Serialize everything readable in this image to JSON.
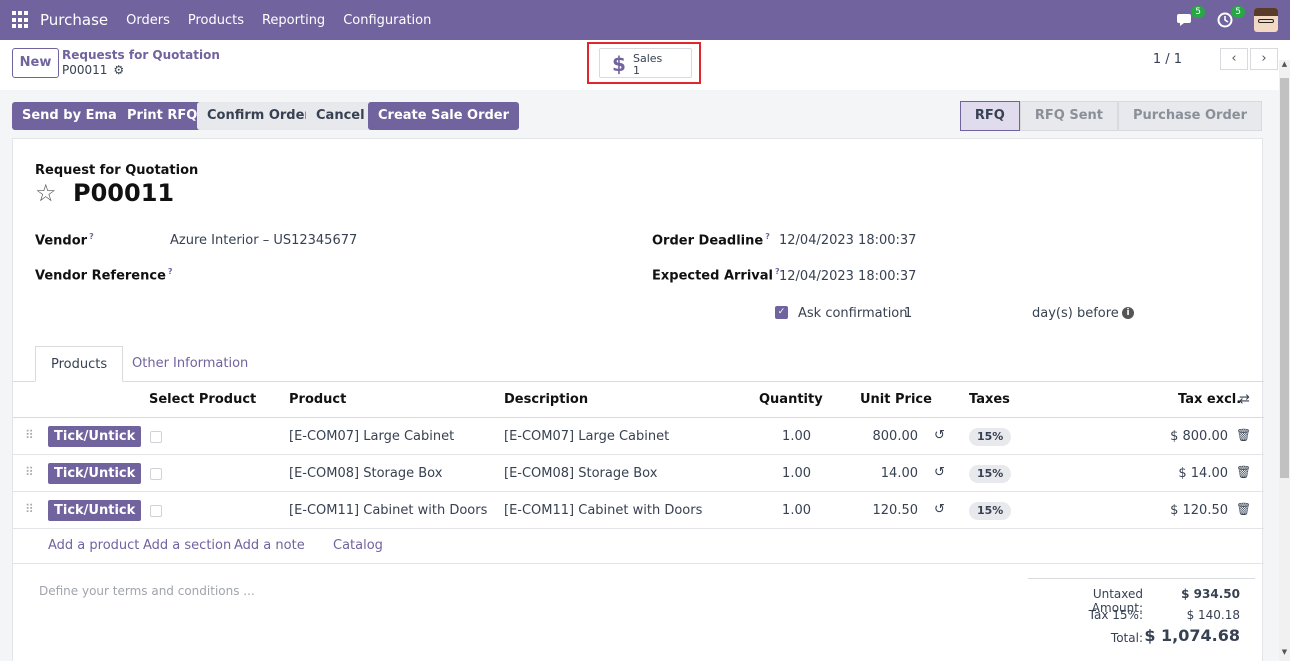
{
  "navbar": {
    "app_title": "Purchase",
    "menu": [
      "Orders",
      "Products",
      "Reporting",
      "Configuration"
    ],
    "messages_count": "5",
    "activities_count": "5"
  },
  "control": {
    "new_label": "New",
    "breadcrumb_parent": "Requests for Quotation",
    "breadcrumb_current": "P00011",
    "smart_button": {
      "label": "Sales",
      "value": "1",
      "icon": "dollar-icon"
    },
    "pager": "1 / 1"
  },
  "actions": {
    "send_email": "Send by Email",
    "print_rfq": "Print RFQ",
    "confirm_order": "Confirm Order",
    "cancel": "Cancel",
    "create_sale_order": "Create Sale Order"
  },
  "status": {
    "steps": [
      "RFQ",
      "RFQ Sent",
      "Purchase Order"
    ],
    "active": "RFQ"
  },
  "form": {
    "doc_type": "Request for Quotation",
    "name": "P00011",
    "vendor_label": "Vendor",
    "vendor_value": "Azure Interior – US12345677",
    "vendor_ref_label": "Vendor Reference",
    "deadline_label": "Order Deadline",
    "deadline_value": "12/04/2023 18:00:37",
    "arrival_label": "Expected Arrival",
    "arrival_value": "12/04/2023 18:00:37",
    "ask_confirmation_label": "Ask confirmation",
    "ask_confirmation_days": "1",
    "days_before": "day(s) before",
    "help_mark": "?"
  },
  "tabs": [
    "Products",
    "Other Information"
  ],
  "table": {
    "headers": {
      "select_product": "Select Product",
      "product": "Product",
      "description": "Description",
      "quantity": "Quantity",
      "unit_price": "Unit Price",
      "taxes": "Taxes",
      "tax_excl": "Tax excl."
    },
    "rows": [
      {
        "button": "Tick/Untick",
        "product": "[E-COM07] Large Cabinet",
        "description": "[E-COM07] Large Cabinet",
        "quantity": "1.00",
        "unit_price": "800.00",
        "tax": "15%",
        "subtotal": "$ 800.00"
      },
      {
        "button": "Tick/Untick",
        "product": "[E-COM08] Storage Box",
        "description": "[E-COM08] Storage Box",
        "quantity": "1.00",
        "unit_price": "14.00",
        "tax": "15%",
        "subtotal": "$ 14.00"
      },
      {
        "button": "Tick/Untick",
        "product": "[E-COM11] Cabinet with Doors",
        "description": "[E-COM11] Cabinet with Doors",
        "quantity": "1.00",
        "unit_price": "120.50",
        "tax": "15%",
        "subtotal": "$ 120.50"
      }
    ],
    "add_links": [
      "Add a product",
      "Add a section",
      "Add a note",
      "Catalog"
    ]
  },
  "terms_placeholder": "Define your terms and conditions ...",
  "totals": {
    "untaxed_label": "Untaxed Amount:",
    "untaxed_value": "$ 934.50",
    "tax_label": "Tax 15%:",
    "tax_value": "$ 140.18",
    "total_label": "Total:",
    "total_value": "$ 1,074.68"
  },
  "colors": {
    "brand": "#71639e",
    "highlight": "#e0262b"
  }
}
